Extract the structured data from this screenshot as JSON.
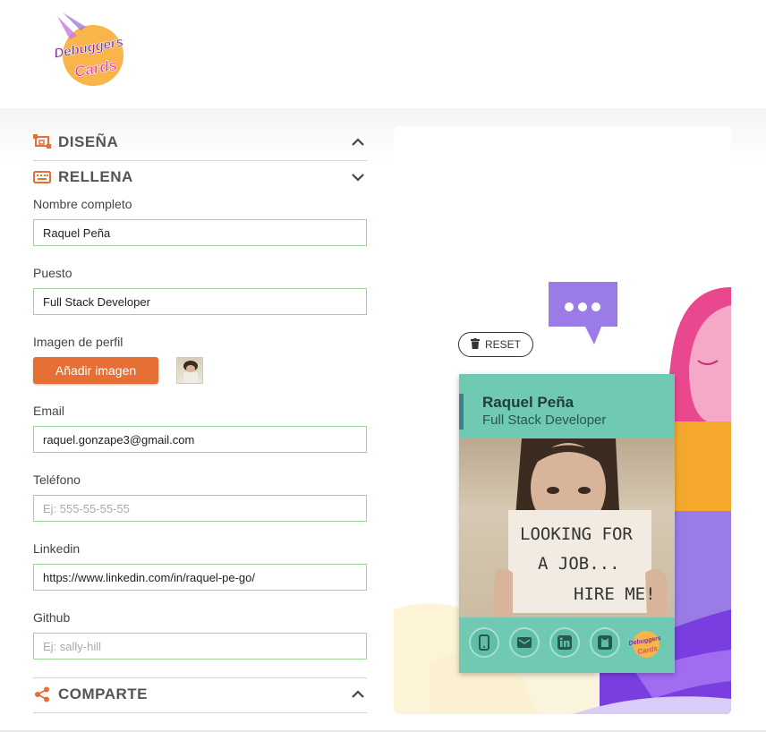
{
  "logo": {
    "line1": "Debuggers",
    "line2": "Cards"
  },
  "sections": {
    "design": {
      "title": "DISEÑA"
    },
    "fill": {
      "title": "RELLENA"
    },
    "share": {
      "title": "COMPARTE"
    }
  },
  "form": {
    "name_label": "Nombre completo",
    "name_value": "Raquel Peña",
    "job_label": "Puesto",
    "job_value": "Full Stack Developer",
    "image_label": "Imagen de perfil",
    "add_image_button": "Añadir imagen",
    "email_label": "Email",
    "email_value": "raquel.gonzape3@gmail.com",
    "phone_label": "Teléfono",
    "phone_placeholder": "Ej: 555-55-55-55",
    "linkedin_label": "Linkedin",
    "linkedin_value": "https://www.linkedin.com/in/raquel-pe-go/",
    "github_label": "Github",
    "github_placeholder": "Ej: sally-hill"
  },
  "preview": {
    "reset_label": "RESET",
    "card": {
      "name": "Raquel Peña",
      "job": "Full Stack Developer",
      "photo_sign": [
        "LOOKING FOR",
        "A JOB...",
        "HIRE ME!"
      ],
      "mini_logo": {
        "line1": "Debuggers",
        "line2": "Cards"
      }
    }
  },
  "colors": {
    "accent": "#e66f35",
    "card_bg": "#6fc9b3",
    "card_bar": "#3f7f86",
    "input_border": "#9ed39a",
    "bubble": "#9b7be6",
    "pink_hair": "#e9488f"
  },
  "icons": {
    "design": "layout-icon",
    "fill": "keyboard-icon",
    "share": "share-icon",
    "reset": "trash-icon",
    "social": [
      "mobile-icon",
      "email-icon",
      "linkedin-icon",
      "github-icon"
    ]
  }
}
